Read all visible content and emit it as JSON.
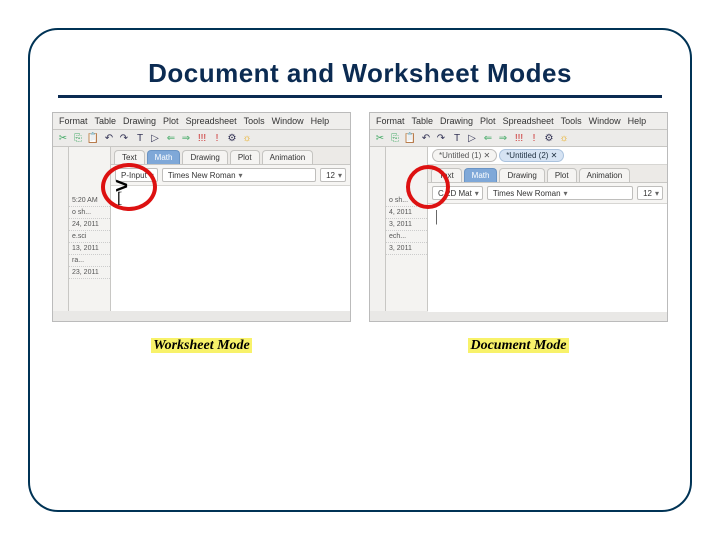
{
  "title": "Document and Worksheet Modes",
  "menus": [
    "Format",
    "Table",
    "Drawing",
    "Plot",
    "Spreadsheet",
    "Tools",
    "Window",
    "Help"
  ],
  "toolbar_icons": [
    "✂",
    "⎘",
    "📋",
    "",
    "↶",
    "↷",
    "",
    "T",
    "▷",
    "",
    "⇐",
    "⇒",
    "",
    "!!!",
    "!",
    "⚙",
    "☼"
  ],
  "left": {
    "tabs": [
      "Text",
      "Math",
      "Drawing",
      "Plot",
      "Animation"
    ],
    "active_tab": "Math",
    "dropdown1": "P-Input",
    "font": "Times New Roman",
    "size": "12",
    "side_items": [
      "5:20 AM",
      "o sh...",
      "24, 2011",
      "e.sci",
      "13, 2011",
      "ra...",
      "23, 2011"
    ],
    "prompt": ">",
    "caption": "Worksheet Mode"
  },
  "right": {
    "doc_tabs": [
      "*Untitled (1)",
      "*Untitled (2)"
    ],
    "tabs": [
      "Text",
      "Math",
      "Drawing",
      "Plot",
      "Animation"
    ],
    "active_tab": "Math",
    "dropdown1": "C  2D Mat",
    "font": "Times New Roman",
    "size": "12",
    "side_items": [
      "o sh...",
      "4, 2011",
      "3, 2011",
      "ech...",
      "3, 2011"
    ],
    "caption": "Document Mode"
  }
}
